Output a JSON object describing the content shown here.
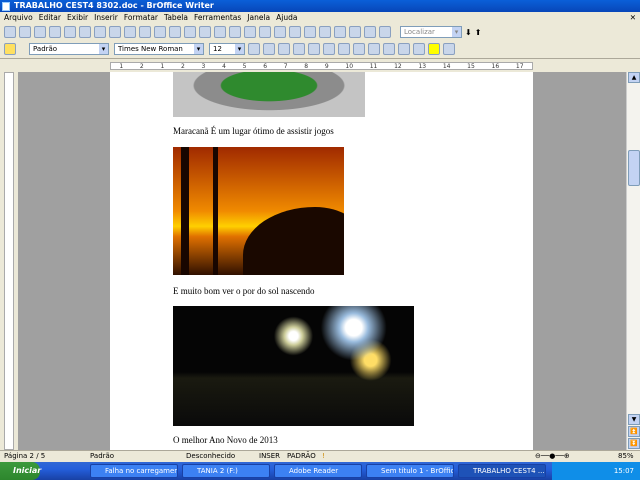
{
  "window": {
    "title": "TRABALHO CEST4 8302.doc - BrOffice Writer"
  },
  "menu": [
    "Arquivo",
    "Editar",
    "Exibir",
    "Inserir",
    "Formatar",
    "Tabela",
    "Ferramentas",
    "Janela",
    "Ajuda"
  ],
  "toolbar": {
    "search_placeholder": "Localizar",
    "style": "Padrão",
    "font": "Times New Roman",
    "size": "12"
  },
  "ruler": [
    "1",
    "2",
    "1",
    "2",
    "3",
    "4",
    "5",
    "6",
    "7",
    "8",
    "9",
    "10",
    "11",
    "12",
    "13",
    "14",
    "15",
    "16",
    "17"
  ],
  "document": {
    "captions": [
      "Maracanã É um lugar ótimo de assistir jogos",
      "E muito bom ver o por do sol nascendo",
      "O melhor Ano Novo de  2013"
    ]
  },
  "status": {
    "page": "Página 2 / 5",
    "style": "Padrão",
    "language": "Desconhecido",
    "mode": "INSER",
    "selection": "PADRÃO",
    "zoom": "85%"
  },
  "taskbar": {
    "start": "Iniciar",
    "tasks": [
      "Falha no carregamen...",
      "TANIA 2 (F:)",
      "Adobe Reader",
      "Sem título 1 - BrOffic...",
      "TRABALHO CEST4 ..."
    ],
    "clock": "15:07"
  }
}
